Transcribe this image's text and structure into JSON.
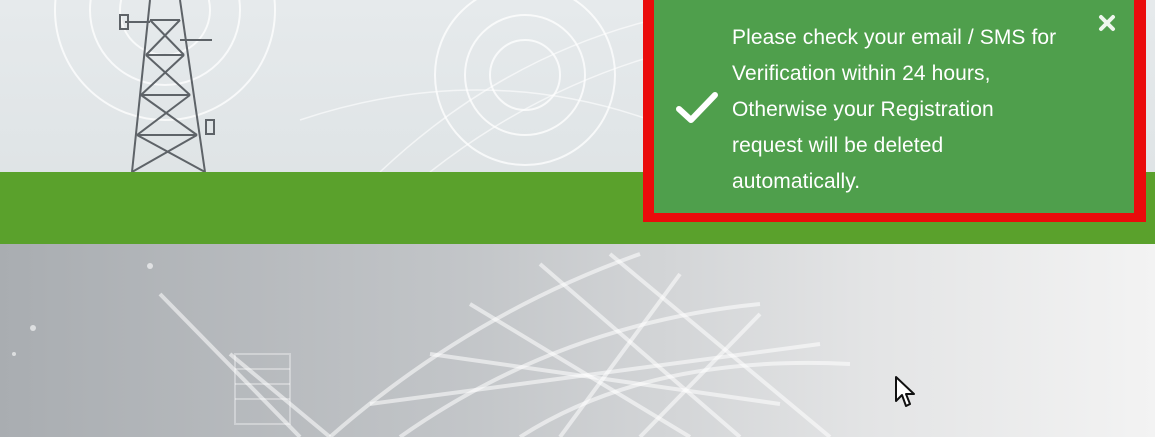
{
  "notification": {
    "message": "Please check your email / SMS for\nVerification within 24 hours,\nOtherwise your Registration\nrequest will be deleted\nautomatically.",
    "status": "success",
    "icon": "checkmark-icon",
    "close_icon": "close-icon"
  },
  "colors": {
    "banner_green": "#5aa12c",
    "toast_green": "#4f9f4c",
    "highlight_red": "#ea0b0b",
    "text": "#ffffff"
  }
}
